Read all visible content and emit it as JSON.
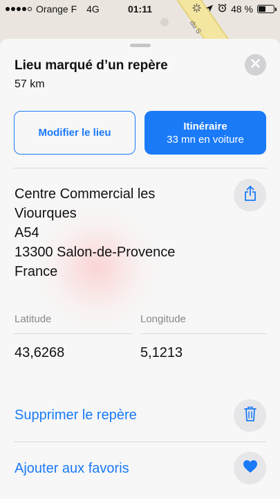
{
  "status_bar": {
    "carrier": "Orange F",
    "network": "4G",
    "time": "01:11",
    "battery": "48 %",
    "battery_level": 0.48,
    "signal_bars": 4
  },
  "map": {
    "road_label": "du S"
  },
  "card": {
    "title": "Lieu marqué d’un repère",
    "distance": "57 km",
    "edit_button": "Modifier le lieu",
    "route_button": {
      "label": "Itinéraire",
      "detail": "33 mn en voiture"
    },
    "address_lines": [
      "Centre Commercial les",
      "Viourques",
      "A54",
      "13300 Salon-de-Provence",
      "France"
    ],
    "latitude": {
      "label": "Latitude",
      "value": "43,6268"
    },
    "longitude": {
      "label": "Longitude",
      "value": "5,1213"
    },
    "actions": {
      "remove": "Supprimer le repère",
      "favorite": "Ajouter aux favoris"
    }
  },
  "colors": {
    "accent": "#1a7af8",
    "card_bg": "#f7f7f7",
    "icon_bg": "#e6e6e9"
  },
  "icons": {
    "close": "close-icon",
    "share": "share-icon",
    "trash": "trash-icon",
    "heart": "heart-icon",
    "location_arrow": "location-arrow-icon",
    "alarm": "alarm-icon",
    "activity": "activity-spinner-icon"
  }
}
